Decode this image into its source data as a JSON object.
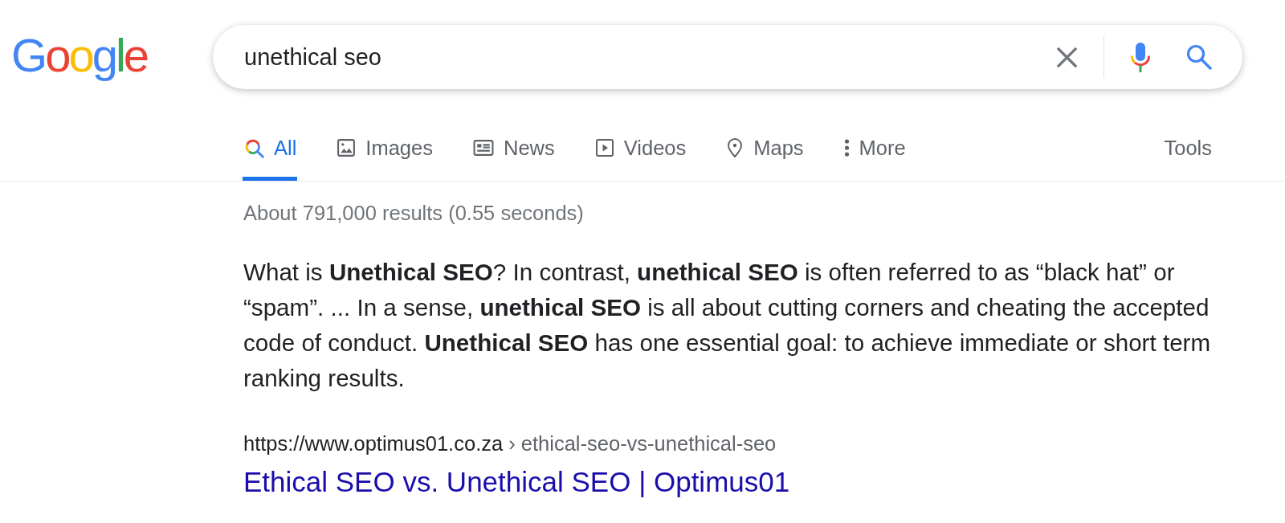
{
  "logo": {
    "text": "Google"
  },
  "search": {
    "value": "unethical seo"
  },
  "tabs": [
    {
      "kind": "all",
      "label": "All",
      "selected": true
    },
    {
      "kind": "images",
      "label": "Images",
      "selected": false
    },
    {
      "kind": "news",
      "label": "News",
      "selected": false
    },
    {
      "kind": "videos",
      "label": "Videos",
      "selected": false
    },
    {
      "kind": "maps",
      "label": "Maps",
      "selected": false
    },
    {
      "kind": "more",
      "label": "More",
      "selected": false
    }
  ],
  "tools": {
    "label": "Tools"
  },
  "result_stats": "About 791,000 results (0.55 seconds)",
  "featured_snippet": {
    "text": "What is **Unethical SEO**? In contrast, **unethical SEO** is often referred to as “black hat” or “spam”. ... In a sense, **unethical SEO** is all about cutting corners and cheating the accepted code of conduct. **Unethical SEO** has one essential goal: to achieve immediate or short term ranking results."
  },
  "result": {
    "url": "https://www.optimus01.co.za",
    "breadcrumb": "› ethical-seo-vs-unethical-seo",
    "title": "Ethical SEO vs. Unethical SEO | Optimus01"
  }
}
